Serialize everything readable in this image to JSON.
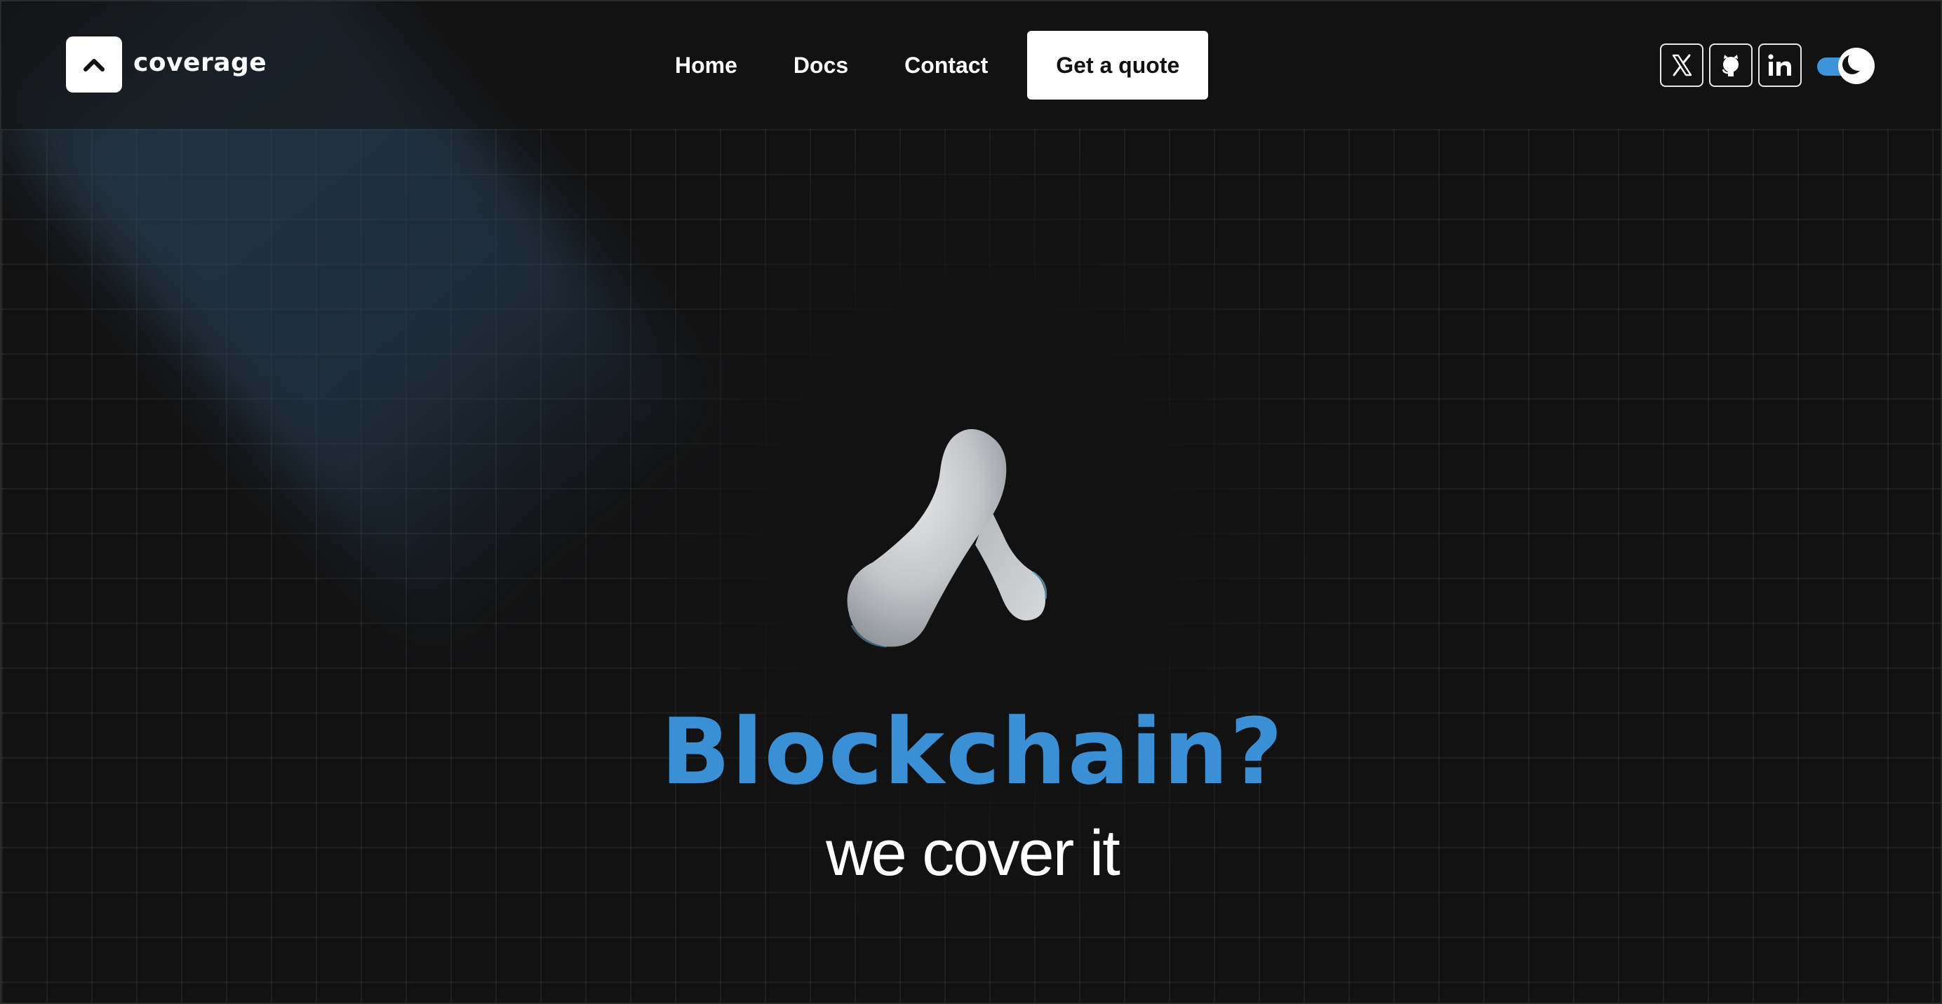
{
  "brand": {
    "name": "coverage",
    "logo_icon": "caret-up-icon"
  },
  "nav": {
    "items": [
      {
        "label": "Home"
      },
      {
        "label": "Docs"
      },
      {
        "label": "Contact"
      }
    ],
    "cta_label": "Get a quote"
  },
  "social": {
    "items": [
      {
        "icon": "x-twitter-icon"
      },
      {
        "icon": "github-icon"
      },
      {
        "icon": "linkedin-icon"
      }
    ]
  },
  "theme_toggle": {
    "icon": "moon-icon",
    "state": "dark",
    "accent": "#3f93d8"
  },
  "hero": {
    "title": "Blockchain?",
    "subtitle": "we cover it",
    "title_color": "#3b8fd5"
  }
}
